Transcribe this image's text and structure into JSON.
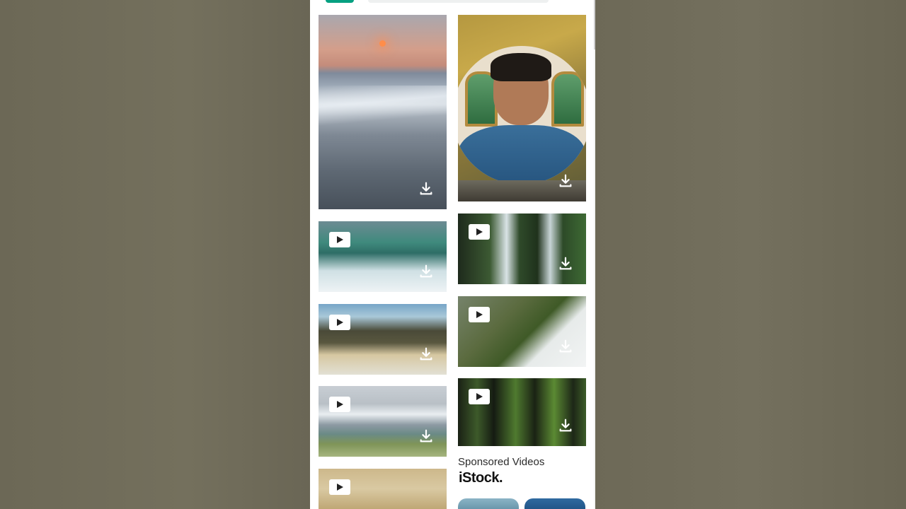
{
  "feed": {
    "sponsored_label": "Sponsored Videos",
    "sponsor_brand": "iStock."
  },
  "tiles": [
    {
      "subject": "sunset beach",
      "has_video_badge": false
    },
    {
      "subject": "presenter in circular frame",
      "has_video_badge": false
    },
    {
      "subject": "waterfall edge",
      "has_video_badge": true
    },
    {
      "subject": "forest waterfalls",
      "has_video_badge": true
    },
    {
      "subject": "mountain valley",
      "has_video_badge": true
    },
    {
      "subject": "misty green ridge",
      "has_video_badge": true
    },
    {
      "subject": "snowy mountains and lake",
      "has_video_badge": true
    },
    {
      "subject": "forest trees",
      "has_video_badge": true
    },
    {
      "subject": "sand dunes",
      "has_video_badge": true
    }
  ],
  "icons": {
    "video": "play-icon",
    "download": "download-icon"
  },
  "colors": {
    "brand_accent": "#05a081",
    "page_background": "#ffffff",
    "backdrop": "#6c6856"
  }
}
